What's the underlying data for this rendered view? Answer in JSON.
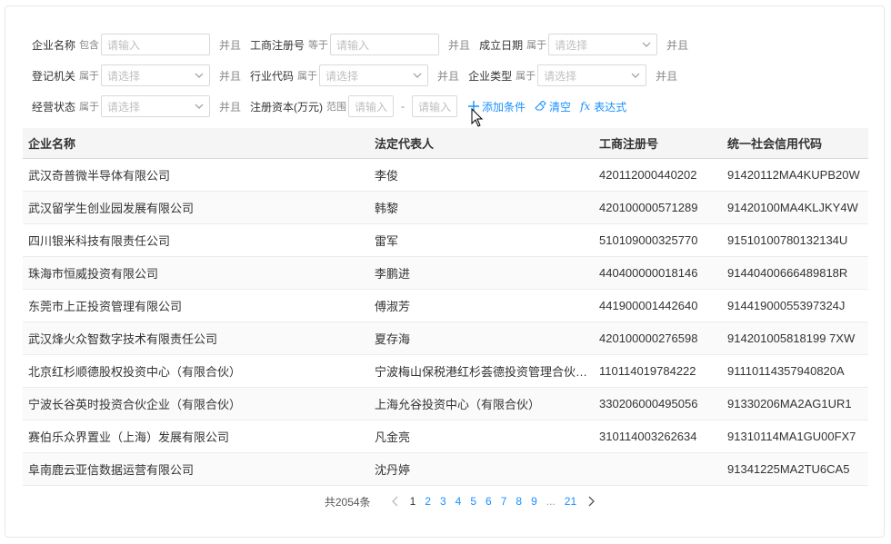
{
  "filters": {
    "row1": {
      "company_name": {
        "label": "企业名称",
        "op": "包含",
        "placeholder": "请输入"
      },
      "reg_no": {
        "label": "工商注册号",
        "op": "等于",
        "placeholder": "请输入"
      },
      "est_date": {
        "label": "成立日期",
        "op": "属于",
        "placeholder": "请选择"
      }
    },
    "row2": {
      "reg_authority": {
        "label": "登记机关",
        "op": "属于",
        "placeholder": "请选择"
      },
      "industry_code": {
        "label": "行业代码",
        "op": "属于",
        "placeholder": "请选择"
      },
      "company_type": {
        "label": "企业类型",
        "op": "属于",
        "placeholder": "请选择"
      }
    },
    "row3": {
      "biz_status": {
        "label": "经营状态",
        "op": "属于",
        "placeholder": "请选择"
      },
      "reg_capital": {
        "label": "注册资本(万元)",
        "op": "范围",
        "placeholder_min": "请输入",
        "placeholder_max": "请输入",
        "dash": "-"
      }
    },
    "and_label": "并且",
    "actions": {
      "add": "添加条件",
      "clear": "清空",
      "expr": "表达式",
      "expr_glyph": "fx"
    }
  },
  "table": {
    "columns": [
      "企业名称",
      "法定代表人",
      "工商注册号",
      "统一社会信用代码"
    ],
    "rows": [
      [
        "武汉奇普微半导体有限公司",
        "李俊",
        "420112000440202",
        "91420112MA4KUPB20W"
      ],
      [
        "武汉留学生创业园发展有限公司",
        "韩黎",
        "420100000571289",
        "91420100MA4KLJKY4W"
      ],
      [
        "四川银米科技有限责任公司",
        "雷军",
        "510109000325770",
        "91510100780132134U"
      ],
      [
        "珠海市恒威投资有限公司",
        "李鹏进",
        "440400000018146",
        "91440400666489818R"
      ],
      [
        "东莞市上正投资管理有限公司",
        "傅淑芳",
        "441900001442640",
        "91441900055397324J"
      ],
      [
        "武汉烽火众智数字技术有限责任公司",
        "夏存海",
        "420100000276598",
        "914201005818199 7XW"
      ],
      [
        "北京红杉顺德股权投资中心（有限合伙）",
        "宁波梅山保税港红杉荟德投资管理合伙企业（有限合伙）",
        "110114019784222",
        "91110114357940820A"
      ],
      [
        "宁波长谷英时投资合伙企业（有限合伙）",
        "上海允谷投资中心（有限合伙）",
        "330206000495056",
        "91330206MA2AG1UR1"
      ],
      [
        "赛伯乐众界置业（上海）发展有限公司",
        "凡金亮",
        "310114003262634",
        "91310114MA1GU00FX7"
      ],
      [
        "阜南鹿云亚信数据运营有限公司",
        "沈丹婷",
        "",
        "91341225MA2TU6CA5"
      ]
    ]
  },
  "pagination": {
    "total": "共2054条",
    "pages": [
      "1",
      "2",
      "3",
      "4",
      "5",
      "6",
      "7",
      "8",
      "9"
    ],
    "ellipsis": "...",
    "last": "21",
    "current": "1"
  }
}
